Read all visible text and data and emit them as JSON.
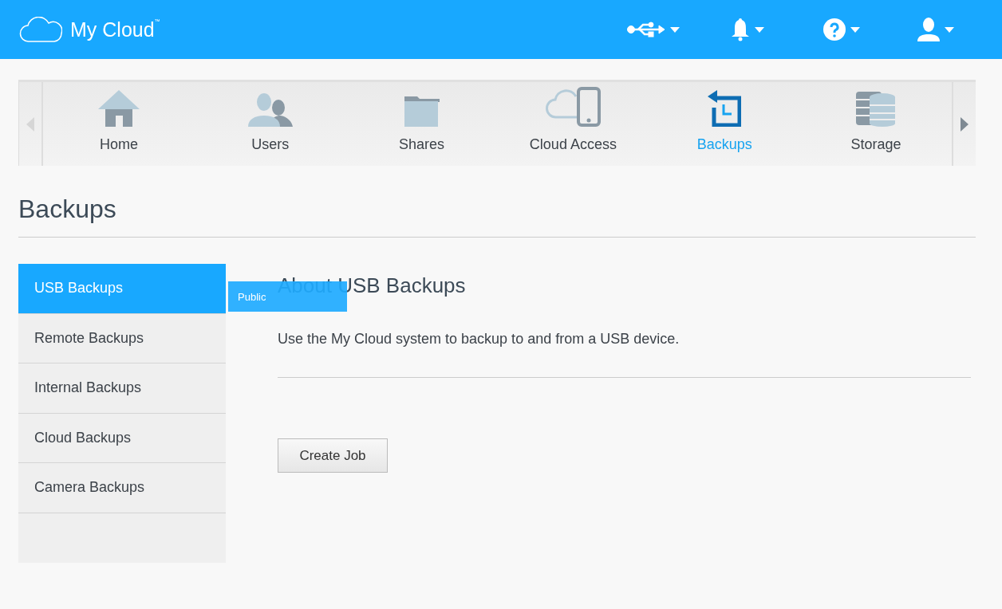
{
  "header": {
    "brand": "My Cloud",
    "trademark": "™",
    "tools": [
      {
        "kind": "usb"
      },
      {
        "kind": "bell"
      },
      {
        "kind": "help"
      },
      {
        "kind": "user"
      }
    ]
  },
  "nav": {
    "tabs": [
      {
        "kind": "home",
        "label": "Home",
        "selected": false
      },
      {
        "kind": "users",
        "label": "Users",
        "selected": false
      },
      {
        "kind": "shares",
        "label": "Shares",
        "selected": false
      },
      {
        "kind": "cloud",
        "label": "Cloud Access",
        "selected": false
      },
      {
        "kind": "backups",
        "label": "Backups",
        "selected": true
      },
      {
        "kind": "storage",
        "label": "Storage",
        "selected": false
      }
    ]
  },
  "page_title": "Backups",
  "sidebar": {
    "items": [
      {
        "label": "USB Backups",
        "selected": true
      },
      {
        "label": "Remote Backups",
        "selected": false
      },
      {
        "label": "Internal Backups",
        "selected": false
      },
      {
        "label": "Cloud Backups",
        "selected": false
      },
      {
        "label": "Camera Backups",
        "selected": false
      }
    ]
  },
  "content": {
    "heading": "About USB Backups",
    "description": "Use the My Cloud system to backup to and from a USB device.",
    "button": "Create Job"
  },
  "tooltip": "Public"
}
